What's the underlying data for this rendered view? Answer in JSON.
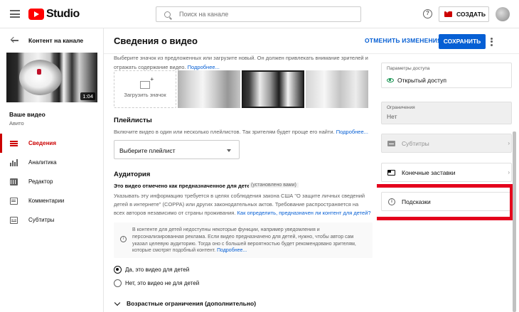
{
  "topbar": {
    "logo_text": "Studio",
    "search_placeholder": "Поиск на канале",
    "help_glyph": "?",
    "create_label": "СОЗДАТЬ"
  },
  "sidebar": {
    "back_label": "Контент на канале",
    "duration": "1:04",
    "video_label": "Ваше видео",
    "channel": "Авито",
    "items": [
      {
        "label": "Сведения",
        "icon": "details-icon",
        "active": true
      },
      {
        "label": "Аналитика",
        "icon": "analytics-icon",
        "active": false
      },
      {
        "label": "Редактор",
        "icon": "editor-icon",
        "active": false
      },
      {
        "label": "Комментарии",
        "icon": "comments-icon",
        "active": false
      },
      {
        "label": "Субтитры",
        "icon": "subtitles-icon",
        "active": false
      }
    ]
  },
  "header": {
    "title": "Сведения о видео",
    "undo_label": "ОТМЕНИТЬ ИЗМЕНЕНИЯ",
    "save_label": "СОХРАНИТЬ"
  },
  "thumbnail_section": {
    "intro_line1": "Выберите значок из предложенных или загрузите новый. Он должен привлекать внимание зрителей и",
    "intro_line2": "отражать содержание видео.",
    "intro_link": "Подробнее...",
    "upload_label": "Загрузить значок"
  },
  "playlists": {
    "title": "Плейлисты",
    "desc": "Включите видео в один или несколько плейлистов. Так зрителям будет проще его найти.",
    "link": "Подробнее...",
    "dropdown_label": "Выберите плейлист"
  },
  "audience": {
    "title": "Аудитория",
    "subtitle": "Это видео отмечено как предназначенное для детей",
    "subtitle_tag": "(установлено вами)",
    "desc_line1": "Указывать эту информацию требуется в целях соблюдения закона США \"О защите личных сведений",
    "desc_line2": "детей в интернете\" (COPPA) или других законодательных актов. Требование распространяется на",
    "desc_line3": "всех авторов независимо от страны проживания.",
    "desc_link": "Как определить, предназначен ли контент для детей?",
    "info_glyph": "i",
    "info_line1": "В контенте для детей недоступны некоторые функции, например уведомления и",
    "info_line2": "персонализированная реклама. Если видео предназначено для детей, нужно, чтобы автор сам",
    "info_line3": "указал целевую аудиторию. Тогда оно с большей вероятностью будет рекомендовано зрителям,",
    "info_line4": "которые смотрят подобный контент.",
    "info_link": "Подробнее...",
    "option_yes": "Да, это видео для детей",
    "option_no": "Нет, это видео не для детей",
    "selected": "yes",
    "age_label": "Возрастные ограничения (дополнительно)"
  },
  "right_panel": {
    "access_label": "Параметры доступа",
    "access_value": "Открытый доступ",
    "restrictions_label": "Ограничения",
    "restrictions_value": "Нет",
    "subtitles_label": "Субтитры",
    "endscreens_label": "Конечные заставки",
    "cards_label": "Подсказки",
    "info_glyph": "i",
    "edge_glyph": "›"
  },
  "colors": {
    "accent": "#065fd4",
    "active_nav": "#cc0000",
    "highlight": "#e4001c",
    "public_icon": "#0a8d48"
  }
}
